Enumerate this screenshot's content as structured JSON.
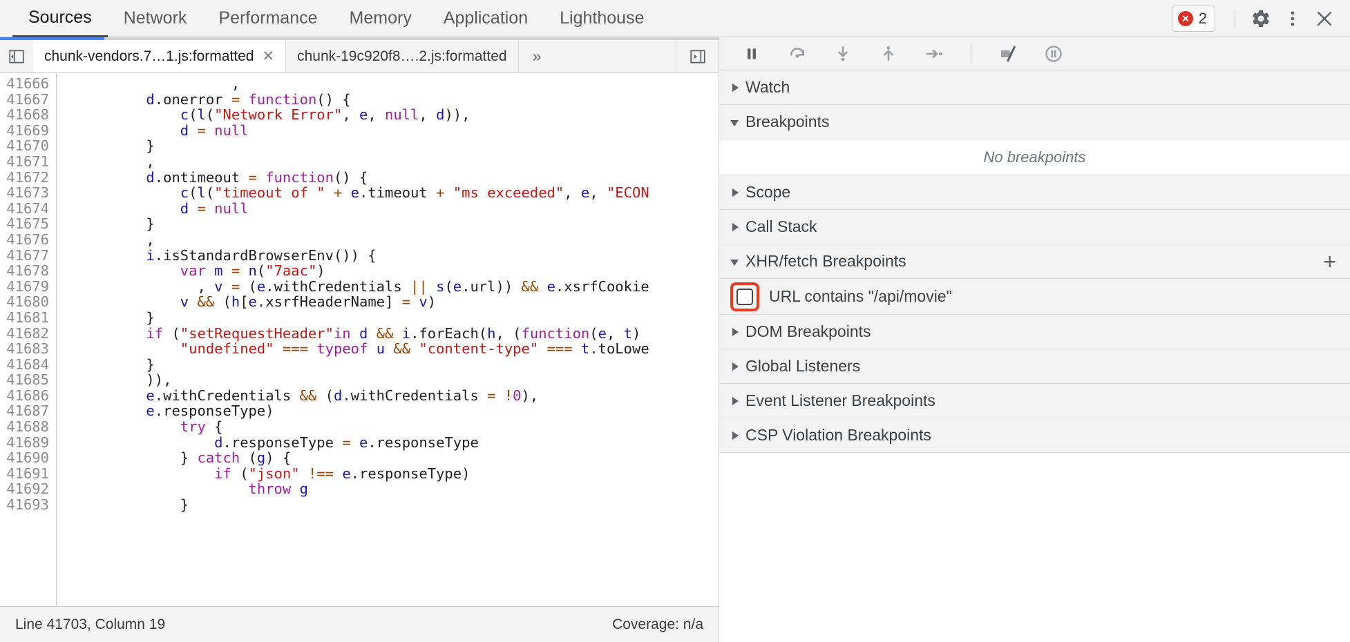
{
  "toolbar": {
    "panel_tabs": [
      {
        "label": "Sources",
        "active": true
      },
      {
        "label": "Network",
        "active": false
      },
      {
        "label": "Performance",
        "active": false
      },
      {
        "label": "Memory",
        "active": false
      },
      {
        "label": "Application",
        "active": false
      },
      {
        "label": "Lighthouse",
        "active": false
      }
    ],
    "error_count": "2",
    "error_icon": "error-circle-icon",
    "settings_icon": "gear-icon",
    "more_icon": "kebab-menu-icon",
    "close_icon": "close-icon"
  },
  "editor": {
    "navigator_toggle_icon": "show-navigator-icon",
    "progress_percent": 14.5,
    "tabs": [
      {
        "label": "chunk-vendors.7…1.js:formatted",
        "active": true,
        "closable": true,
        "close_glyph": "✕"
      },
      {
        "label": "chunk-19c920f8….2.js:formatted",
        "active": false,
        "closable": false,
        "close_glyph": ""
      }
    ],
    "more_tabs_glyph": "»",
    "prettyprint_icon": "show-debugger-icon",
    "first_line_number": 41666,
    "lines": [
      {
        "n": 41666,
        "tokens": [
          {
            "t": "                    ,",
            "c": "pl"
          }
        ]
      },
      {
        "n": 41667,
        "tokens": [
          {
            "t": "          ",
            "c": "pl"
          },
          {
            "t": "d",
            "c": "id"
          },
          {
            "t": ".onerror ",
            "c": "pl"
          },
          {
            "t": "=",
            "c": "op"
          },
          {
            "t": " ",
            "c": "pl"
          },
          {
            "t": "function",
            "c": "kw"
          },
          {
            "t": "() {",
            "c": "pl"
          }
        ]
      },
      {
        "n": 41668,
        "tokens": [
          {
            "t": "              ",
            "c": "pl"
          },
          {
            "t": "c",
            "c": "id"
          },
          {
            "t": "(",
            "c": "pl"
          },
          {
            "t": "l",
            "c": "id"
          },
          {
            "t": "(",
            "c": "pl"
          },
          {
            "t": "\"Network Error\"",
            "c": "str"
          },
          {
            "t": ", ",
            "c": "pl"
          },
          {
            "t": "e",
            "c": "id"
          },
          {
            "t": ", ",
            "c": "pl"
          },
          {
            "t": "null",
            "c": "kw"
          },
          {
            "t": ", ",
            "c": "pl"
          },
          {
            "t": "d",
            "c": "id"
          },
          {
            "t": ")),",
            "c": "pl"
          }
        ]
      },
      {
        "n": 41669,
        "tokens": [
          {
            "t": "              ",
            "c": "pl"
          },
          {
            "t": "d",
            "c": "id"
          },
          {
            "t": " ",
            "c": "pl"
          },
          {
            "t": "=",
            "c": "op"
          },
          {
            "t": " ",
            "c": "pl"
          },
          {
            "t": "null",
            "c": "kw"
          }
        ]
      },
      {
        "n": 41670,
        "tokens": [
          {
            "t": "          }",
            "c": "pl"
          }
        ]
      },
      {
        "n": 41671,
        "tokens": [
          {
            "t": "          ,",
            "c": "pl"
          }
        ]
      },
      {
        "n": 41672,
        "tokens": [
          {
            "t": "          ",
            "c": "pl"
          },
          {
            "t": "d",
            "c": "id"
          },
          {
            "t": ".ontimeout ",
            "c": "pl"
          },
          {
            "t": "=",
            "c": "op"
          },
          {
            "t": " ",
            "c": "pl"
          },
          {
            "t": "function",
            "c": "kw"
          },
          {
            "t": "() {",
            "c": "pl"
          }
        ]
      },
      {
        "n": 41673,
        "tokens": [
          {
            "t": "              ",
            "c": "pl"
          },
          {
            "t": "c",
            "c": "id"
          },
          {
            "t": "(",
            "c": "pl"
          },
          {
            "t": "l",
            "c": "id"
          },
          {
            "t": "(",
            "c": "pl"
          },
          {
            "t": "\"timeout of \"",
            "c": "str"
          },
          {
            "t": " ",
            "c": "pl"
          },
          {
            "t": "+",
            "c": "op"
          },
          {
            "t": " ",
            "c": "pl"
          },
          {
            "t": "e",
            "c": "id"
          },
          {
            "t": ".timeout ",
            "c": "pl"
          },
          {
            "t": "+",
            "c": "op"
          },
          {
            "t": " ",
            "c": "pl"
          },
          {
            "t": "\"ms exceeded\"",
            "c": "str"
          },
          {
            "t": ", ",
            "c": "pl"
          },
          {
            "t": "e",
            "c": "id"
          },
          {
            "t": ", ",
            "c": "pl"
          },
          {
            "t": "\"ECON",
            "c": "str"
          }
        ]
      },
      {
        "n": 41674,
        "tokens": [
          {
            "t": "              ",
            "c": "pl"
          },
          {
            "t": "d",
            "c": "id"
          },
          {
            "t": " ",
            "c": "pl"
          },
          {
            "t": "=",
            "c": "op"
          },
          {
            "t": " ",
            "c": "pl"
          },
          {
            "t": "null",
            "c": "kw"
          }
        ]
      },
      {
        "n": 41675,
        "tokens": [
          {
            "t": "          }",
            "c": "pl"
          }
        ]
      },
      {
        "n": 41676,
        "tokens": [
          {
            "t": "          ,",
            "c": "pl"
          }
        ]
      },
      {
        "n": 41677,
        "tokens": [
          {
            "t": "          ",
            "c": "pl"
          },
          {
            "t": "i",
            "c": "id"
          },
          {
            "t": ".isStandardBrowserEnv()) {",
            "c": "pl"
          }
        ]
      },
      {
        "n": 41678,
        "tokens": [
          {
            "t": "              ",
            "c": "pl"
          },
          {
            "t": "var",
            "c": "kw"
          },
          {
            "t": " ",
            "c": "pl"
          },
          {
            "t": "m",
            "c": "id"
          },
          {
            "t": " ",
            "c": "pl"
          },
          {
            "t": "=",
            "c": "op"
          },
          {
            "t": " ",
            "c": "pl"
          },
          {
            "t": "n",
            "c": "id"
          },
          {
            "t": "(",
            "c": "pl"
          },
          {
            "t": "\"7aac\"",
            "c": "str"
          },
          {
            "t": ")",
            "c": "pl"
          }
        ]
      },
      {
        "n": 41679,
        "tokens": [
          {
            "t": "                , ",
            "c": "pl"
          },
          {
            "t": "v",
            "c": "id"
          },
          {
            "t": " ",
            "c": "pl"
          },
          {
            "t": "=",
            "c": "op"
          },
          {
            "t": " (",
            "c": "pl"
          },
          {
            "t": "e",
            "c": "id"
          },
          {
            "t": ".withCredentials ",
            "c": "pl"
          },
          {
            "t": "||",
            "c": "op"
          },
          {
            "t": " ",
            "c": "pl"
          },
          {
            "t": "s",
            "c": "id"
          },
          {
            "t": "(",
            "c": "pl"
          },
          {
            "t": "e",
            "c": "id"
          },
          {
            "t": ".url)) ",
            "c": "pl"
          },
          {
            "t": "&&",
            "c": "op"
          },
          {
            "t": " ",
            "c": "pl"
          },
          {
            "t": "e",
            "c": "id"
          },
          {
            "t": ".xsrfCookie",
            "c": "pl"
          }
        ]
      },
      {
        "n": 41680,
        "tokens": [
          {
            "t": "              ",
            "c": "pl"
          },
          {
            "t": "v",
            "c": "id"
          },
          {
            "t": " ",
            "c": "pl"
          },
          {
            "t": "&&",
            "c": "op"
          },
          {
            "t": " (",
            "c": "pl"
          },
          {
            "t": "h",
            "c": "id"
          },
          {
            "t": "[",
            "c": "pl"
          },
          {
            "t": "e",
            "c": "id"
          },
          {
            "t": ".xsrfHeaderName] ",
            "c": "pl"
          },
          {
            "t": "=",
            "c": "op"
          },
          {
            "t": " ",
            "c": "pl"
          },
          {
            "t": "v",
            "c": "id"
          },
          {
            "t": ")",
            "c": "pl"
          }
        ]
      },
      {
        "n": 41681,
        "tokens": [
          {
            "t": "          }",
            "c": "pl"
          }
        ]
      },
      {
        "n": 41682,
        "tokens": [
          {
            "t": "          ",
            "c": "pl"
          },
          {
            "t": "if",
            "c": "kw"
          },
          {
            "t": " (",
            "c": "pl"
          },
          {
            "t": "\"setRequestHeader\"",
            "c": "str"
          },
          {
            "t": "in",
            "c": "kw"
          },
          {
            "t": " ",
            "c": "pl"
          },
          {
            "t": "d",
            "c": "id"
          },
          {
            "t": " ",
            "c": "pl"
          },
          {
            "t": "&&",
            "c": "op"
          },
          {
            "t": " ",
            "c": "pl"
          },
          {
            "t": "i",
            "c": "id"
          },
          {
            "t": ".forEach(",
            "c": "pl"
          },
          {
            "t": "h",
            "c": "id"
          },
          {
            "t": ", (",
            "c": "pl"
          },
          {
            "t": "function",
            "c": "kw"
          },
          {
            "t": "(",
            "c": "pl"
          },
          {
            "t": "e",
            "c": "id"
          },
          {
            "t": ", ",
            "c": "pl"
          },
          {
            "t": "t",
            "c": "id"
          },
          {
            "t": ")",
            "c": "pl"
          }
        ]
      },
      {
        "n": 41683,
        "tokens": [
          {
            "t": "              ",
            "c": "pl"
          },
          {
            "t": "\"undefined\"",
            "c": "str"
          },
          {
            "t": " ",
            "c": "pl"
          },
          {
            "t": "===",
            "c": "op"
          },
          {
            "t": " ",
            "c": "pl"
          },
          {
            "t": "typeof",
            "c": "kw"
          },
          {
            "t": " ",
            "c": "pl"
          },
          {
            "t": "u",
            "c": "id"
          },
          {
            "t": " ",
            "c": "pl"
          },
          {
            "t": "&&",
            "c": "op"
          },
          {
            "t": " ",
            "c": "pl"
          },
          {
            "t": "\"content-type\"",
            "c": "str"
          },
          {
            "t": " ",
            "c": "pl"
          },
          {
            "t": "===",
            "c": "op"
          },
          {
            "t": " ",
            "c": "pl"
          },
          {
            "t": "t",
            "c": "id"
          },
          {
            "t": ".toLowe",
            "c": "pl"
          }
        ]
      },
      {
        "n": 41684,
        "tokens": [
          {
            "t": "          }",
            "c": "pl"
          }
        ]
      },
      {
        "n": 41685,
        "tokens": [
          {
            "t": "          )),",
            "c": "pl"
          }
        ]
      },
      {
        "n": 41686,
        "tokens": [
          {
            "t": "          ",
            "c": "pl"
          },
          {
            "t": "e",
            "c": "id"
          },
          {
            "t": ".withCredentials ",
            "c": "pl"
          },
          {
            "t": "&&",
            "c": "op"
          },
          {
            "t": " (",
            "c": "pl"
          },
          {
            "t": "d",
            "c": "id"
          },
          {
            "t": ".withCredentials ",
            "c": "pl"
          },
          {
            "t": "=",
            "c": "op"
          },
          {
            "t": " ",
            "c": "pl"
          },
          {
            "t": "!",
            "c": "op"
          },
          {
            "t": "0",
            "c": "kw"
          },
          {
            "t": "),",
            "c": "pl"
          }
        ]
      },
      {
        "n": 41687,
        "tokens": [
          {
            "t": "          ",
            "c": "pl"
          },
          {
            "t": "e",
            "c": "id"
          },
          {
            "t": ".responseType)",
            "c": "pl"
          }
        ]
      },
      {
        "n": 41688,
        "tokens": [
          {
            "t": "              ",
            "c": "pl"
          },
          {
            "t": "try",
            "c": "kw"
          },
          {
            "t": " {",
            "c": "pl"
          }
        ]
      },
      {
        "n": 41689,
        "tokens": [
          {
            "t": "                  ",
            "c": "pl"
          },
          {
            "t": "d",
            "c": "id"
          },
          {
            "t": ".responseType ",
            "c": "pl"
          },
          {
            "t": "=",
            "c": "op"
          },
          {
            "t": " ",
            "c": "pl"
          },
          {
            "t": "e",
            "c": "id"
          },
          {
            "t": ".responseType",
            "c": "pl"
          }
        ]
      },
      {
        "n": 41690,
        "tokens": [
          {
            "t": "              } ",
            "c": "pl"
          },
          {
            "t": "catch",
            "c": "kw"
          },
          {
            "t": " (",
            "c": "pl"
          },
          {
            "t": "g",
            "c": "id"
          },
          {
            "t": ") {",
            "c": "pl"
          }
        ]
      },
      {
        "n": 41691,
        "tokens": [
          {
            "t": "                  ",
            "c": "pl"
          },
          {
            "t": "if",
            "c": "kw"
          },
          {
            "t": " (",
            "c": "pl"
          },
          {
            "t": "\"json\"",
            "c": "str"
          },
          {
            "t": " ",
            "c": "pl"
          },
          {
            "t": "!==",
            "c": "op"
          },
          {
            "t": " ",
            "c": "pl"
          },
          {
            "t": "e",
            "c": "id"
          },
          {
            "t": ".responseType)",
            "c": "pl"
          }
        ]
      },
      {
        "n": 41692,
        "tokens": [
          {
            "t": "                      ",
            "c": "pl"
          },
          {
            "t": "throw",
            "c": "kw"
          },
          {
            "t": " ",
            "c": "pl"
          },
          {
            "t": "g",
            "c": "id"
          }
        ]
      },
      {
        "n": 41693,
        "tokens": [
          {
            "t": "              }",
            "c": "pl"
          }
        ]
      }
    ]
  },
  "statusbar": {
    "position": "Line 41703, Column 19",
    "coverage": "Coverage: n/a"
  },
  "debugger": {
    "controls": [
      {
        "name": "resume-button",
        "icon": "pause-icon"
      },
      {
        "name": "step-over-button",
        "icon": "step-over-icon"
      },
      {
        "name": "step-into-button",
        "icon": "step-into-icon"
      },
      {
        "name": "step-out-button",
        "icon": "step-out-icon"
      },
      {
        "name": "step-button",
        "icon": "step-icon"
      },
      {
        "name": "deactivate-breakpoints-button",
        "icon": "deactivate-breakpoints-icon"
      },
      {
        "name": "pause-on-exceptions-button",
        "icon": "pause-on-exceptions-icon"
      }
    ],
    "sections": [
      {
        "label": "Watch",
        "expanded": false,
        "has_add": false
      },
      {
        "label": "Breakpoints",
        "expanded": true,
        "has_add": false,
        "empty_text": "No breakpoints"
      },
      {
        "label": "Scope",
        "expanded": false,
        "has_add": false
      },
      {
        "label": "Call Stack",
        "expanded": false,
        "has_add": false
      },
      {
        "label": "XHR/fetch Breakpoints",
        "expanded": true,
        "has_add": true,
        "add_glyph": "+"
      },
      {
        "label": "DOM Breakpoints",
        "expanded": false,
        "has_add": false
      },
      {
        "label": "Global Listeners",
        "expanded": false,
        "has_add": false
      },
      {
        "label": "Event Listener Breakpoints",
        "expanded": false,
        "has_add": false
      },
      {
        "label": "CSP Violation Breakpoints",
        "expanded": false,
        "has_add": false
      }
    ],
    "xhr_breakpoint": {
      "label": "URL contains \"/api/movie\"",
      "checked": false,
      "highlight_color": "#ea3d20"
    }
  }
}
